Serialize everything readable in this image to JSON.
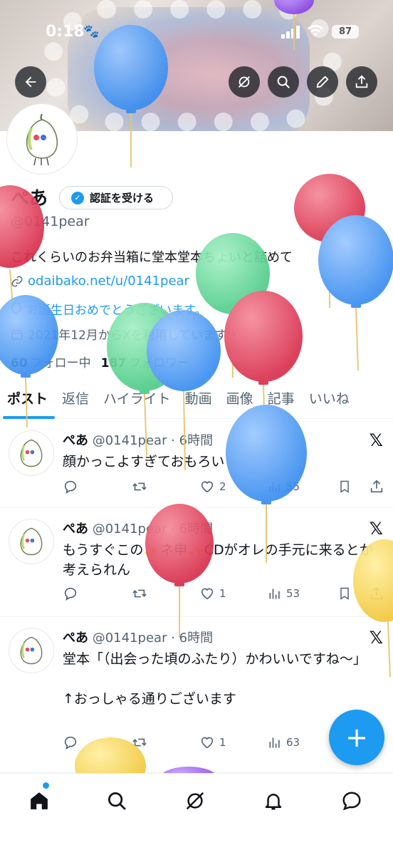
{
  "status_bar": {
    "time": "0:18",
    "battery": "87"
  },
  "profile": {
    "name": "ぺあ",
    "verify_button": "認証を受ける",
    "handle": "@0141pear",
    "bio": "これくらいのお弁当箱に堂本堂本ちょいと詰めて",
    "link": "odaibako.net/u/0141pear",
    "birthday": "お誕生日おめでとうございます。",
    "joined": "2021年12月からXを利用しています",
    "following_count": "60",
    "following_label": "フォロー中",
    "followers_count": "187",
    "followers_label": "フォロワー"
  },
  "tabs": [
    "ポスト",
    "返信",
    "ハイライト",
    "動画",
    "画像",
    "記事",
    "いいね"
  ],
  "posts": [
    {
      "name": "ぺあ",
      "meta": "@0141pear · 6時間",
      "text": "顔かっこよすぎておもろい",
      "likes": "2",
      "views": "55"
    },
    {
      "name": "ぺあ",
      "meta": "@0141pear · 6時間",
      "text": "もうすぐこの✨ネ申✨CDがオレの手元に来るとか考えられん",
      "likes": "1",
      "views": "53"
    },
    {
      "name": "ぺあ",
      "meta": "@0141pear · 6時間",
      "text": "堂本「（出会った頃のふたり）かわいいですね〜」\n\n↑おっしゃる通りございます",
      "likes": "1",
      "views": "63"
    }
  ],
  "icons": {
    "back": "arrow-left-icon",
    "grok": "grok-icon",
    "search": "search-icon",
    "edit": "pencil-icon",
    "share": "share-icon",
    "reply": "reply-icon",
    "repost": "repost-icon",
    "like": "heart-icon",
    "views": "views-icon",
    "bookmark": "bookmark-icon",
    "x": "x-logo-icon",
    "home": "home-icon",
    "bell": "bell-icon",
    "messages": "message-icon"
  },
  "colors": {
    "accent": "#1d9bf0",
    "text": "#0f1419",
    "muted": "#536471"
  }
}
